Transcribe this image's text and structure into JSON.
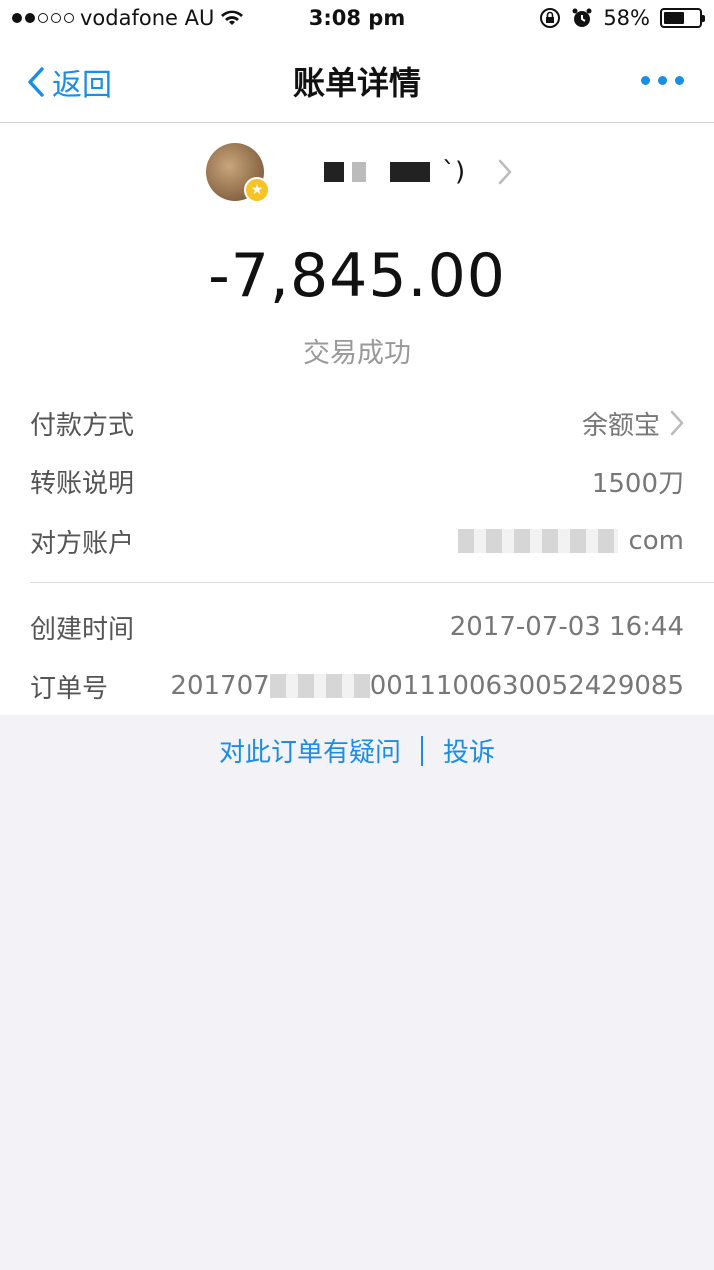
{
  "status_bar": {
    "carrier": "vodafone AU",
    "time": "3:08 pm",
    "battery": "58%",
    "battery_level": 0.58
  },
  "nav": {
    "back_label": "返回",
    "title": "账单详情"
  },
  "payee": {
    "name_suffix": "`)"
  },
  "transaction": {
    "amount": "-7,845.00",
    "status": "交易成功"
  },
  "details": {
    "payment_method_label": "付款方式",
    "payment_method_value": "余额宝",
    "note_label": "转账说明",
    "note_value": "1500刀",
    "account_label": "对方账户",
    "account_value_suffix": "com",
    "created_label": "创建时间",
    "created_value": "2017-07-03 16:44",
    "order_label": "订单号",
    "order_value_prefix": "201707",
    "order_value_suffix": "0011100630052429085"
  },
  "footer": {
    "question_link": "对此订单有疑问",
    "complain_link": "投诉"
  },
  "colors": {
    "accent": "#1a8ee3"
  }
}
